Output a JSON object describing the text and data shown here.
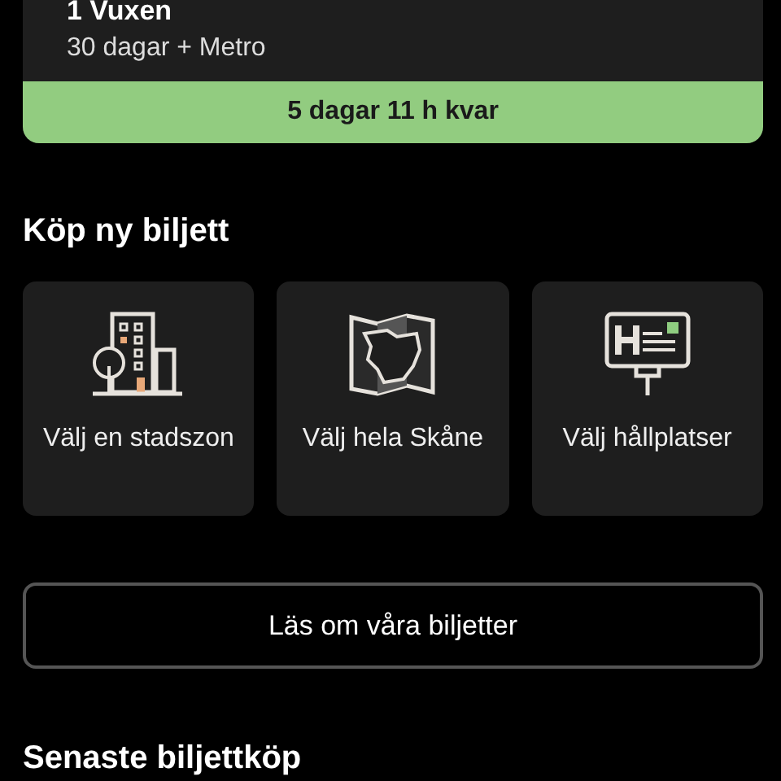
{
  "ticket": {
    "travellers": "1 Vuxen",
    "product": "30 dagar + Metro",
    "remaining": "5 dagar 11 h kvar"
  },
  "buy_section": {
    "title": "Köp ny biljett",
    "options": [
      {
        "kind": "city",
        "label": "Välj en stadszon"
      },
      {
        "kind": "map",
        "label": "Välj hela Skåne"
      },
      {
        "kind": "stop",
        "label": "Välj hållplatser"
      }
    ]
  },
  "info_button": "Läs om våra biljetter",
  "recent_section": {
    "title": "Senaste biljettköp"
  }
}
